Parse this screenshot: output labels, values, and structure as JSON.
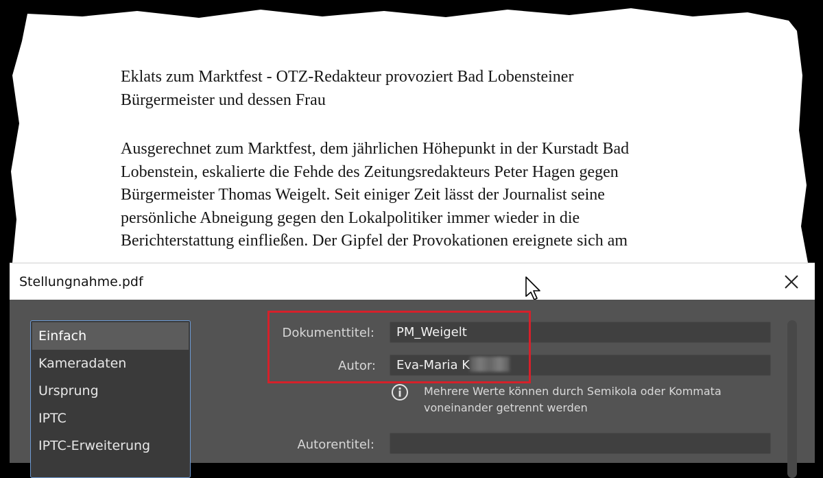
{
  "document": {
    "title_line1": "Eklats zum Marktfest - OTZ-Redakteur provoziert Bad Lobensteiner",
    "title_line2": "Bürgermeister und dessen Frau",
    "body_lines": [
      "Ausgerechnet zum Marktfest, dem jährlichen Höhepunkt in der Kurstadt Bad",
      "Lobenstein, eskalierte die Fehde des Zeitungsredakteurs Peter Hagen gegen",
      "Bürgermeister Thomas Weigelt. Seit einiger Zeit lässt der Journalist seine",
      "persönliche Abneigung gegen den Lokalpolitiker immer wieder in die",
      "Berichterstattung einfließen. Der Gipfel der Provokationen ereignete sich am"
    ]
  },
  "dialog": {
    "title": "Stellungnahme.pdf",
    "close_icon": "close-icon",
    "sidebar": {
      "items": [
        {
          "label": "Einfach",
          "selected": true
        },
        {
          "label": "Kameradaten"
        },
        {
          "label": "Ursprung"
        },
        {
          "label": "IPTC"
        },
        {
          "label": "IPTC-Erweiterung"
        }
      ]
    },
    "fields": {
      "document_title_label": "Dokumenttitel:",
      "document_title_value": "PM_Weigelt",
      "author_label": "Autor:",
      "author_value": "Eva-Maria K",
      "hint": "Mehrere Werte können durch Semikola oder Kommata voneinander getrennt werden",
      "author_title_label": "Autorentitel:",
      "author_title_value": ""
    },
    "colors": {
      "highlight": "#d6202a",
      "panel_bg": "#535353",
      "input_bg": "#404040",
      "sidebar_border": "#6e9bd4"
    }
  }
}
